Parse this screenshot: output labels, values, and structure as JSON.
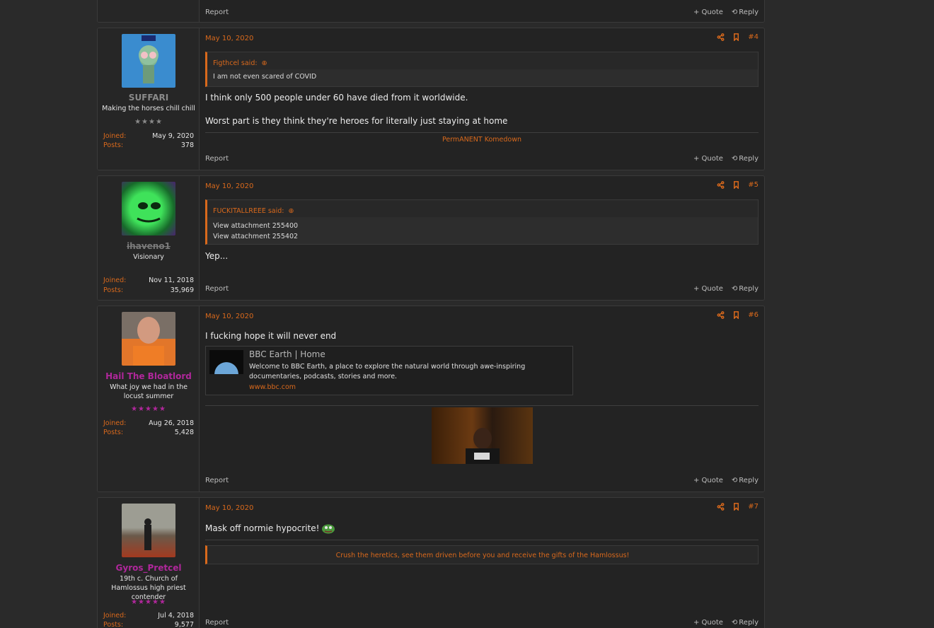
{
  "labels": {
    "report": "Report",
    "quote": "+ Quote",
    "reply": "Reply",
    "joined": "Joined:",
    "posts": "Posts:"
  },
  "posts": [
    {
      "num": "",
      "date": "",
      "user": {
        "name": "",
        "title": "",
        "joined": "",
        "posts": ""
      }
    },
    {
      "num": "#4",
      "date": "May 10, 2020",
      "user": {
        "name": "SUFFARI",
        "title": "Making the horses chill chill",
        "stars": "★★★★",
        "joined": "May 9, 2020",
        "posts": "378"
      },
      "quote": {
        "author": "Figthcel said:",
        "lines": [
          "I am not even scared of COVID"
        ]
      },
      "body": [
        "I think only 500 people under 60 have died from it worldwide.",
        "Worst part is they think they're heroes for literally just staying at home"
      ],
      "signature": "PermANENT Komedown"
    },
    {
      "num": "#5",
      "date": "May 10, 2020",
      "user": {
        "name": "ihaveno1",
        "title": "Visionary",
        "joined": "Nov 11, 2018",
        "posts": "35,969"
      },
      "quote": {
        "author": "FUCKITALLREEE said:",
        "lines": [
          "View attachment 255400",
          "View attachment 255402"
        ]
      },
      "body": [
        "Yep..."
      ]
    },
    {
      "num": "#6",
      "date": "May 10, 2020",
      "user": {
        "name": "Hail The Bloatlord",
        "title": "What joy we had in the locust summer",
        "stars": "★★★★★",
        "joined": "Aug 26, 2018",
        "posts": "5,428"
      },
      "body": [
        "I fucking hope it will never end"
      ],
      "link": {
        "title": "BBC Earth | Home",
        "desc": "Welcome to BBC Earth, a place to explore the natural world through awe-inspiring documentaries, podcasts, stories and more.",
        "url": "www.bbc.com"
      }
    },
    {
      "num": "#7",
      "date": "May 10, 2020",
      "user": {
        "name": "Gyros_Pretcel",
        "title": "19th c. Church of Hamlossus high priest contender",
        "stars": "★★★★★",
        "joined": "Jul 4, 2018",
        "posts": "9,577"
      },
      "body": [
        "Mask off normie hypocrite!"
      ],
      "signature": "Crush the heretics, see them driven before you and receive the gifts of the Hamlossus!"
    }
  ],
  "colors": {
    "accent": "#d9691c",
    "name_purple": "#b0279b",
    "name_grey": "#8a8a8a"
  }
}
